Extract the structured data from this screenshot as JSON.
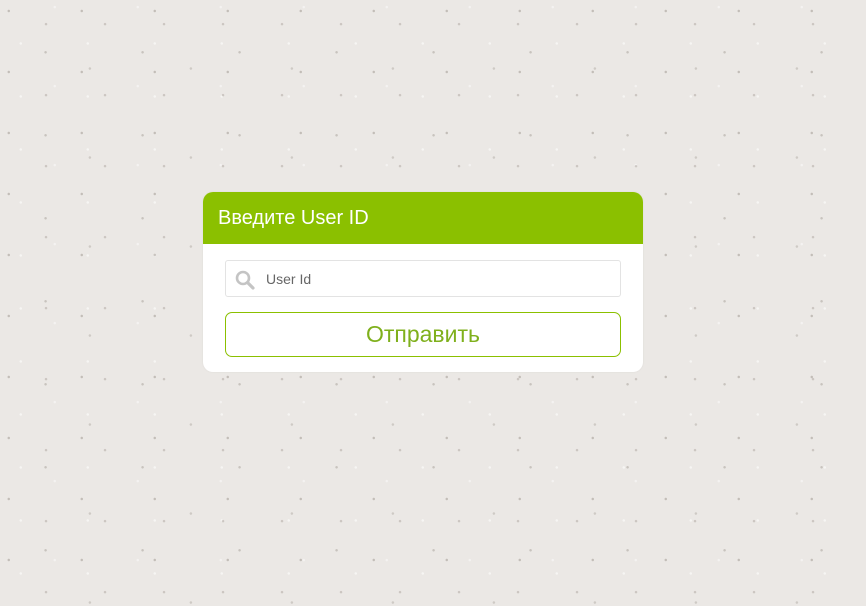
{
  "colors": {
    "header_background": "#8bc000",
    "button_border": "#8bc000",
    "button_text": "#7fb01c",
    "page_background": "#ebe8e5"
  },
  "dialog": {
    "title": "Введите User ID",
    "search": {
      "icon": "search-icon",
      "placeholder": "User Id",
      "value": ""
    },
    "submit_label": "Отправить"
  }
}
